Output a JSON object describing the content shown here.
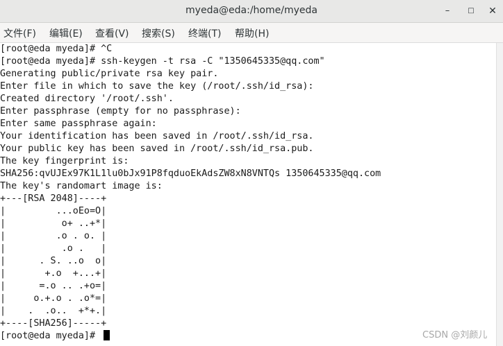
{
  "window": {
    "title": "myeda@eda:/home/myeda",
    "minimize_glyph": "–",
    "maximize_glyph": "□",
    "close_glyph": "✕"
  },
  "menu": {
    "items": [
      {
        "label": "文件(F)"
      },
      {
        "label": "编辑(E)"
      },
      {
        "label": "查看(V)"
      },
      {
        "label": "搜索(S)"
      },
      {
        "label": "终端(T)"
      },
      {
        "label": "帮助(H)"
      }
    ]
  },
  "terminal": {
    "lines": [
      "[root@eda myeda]# ^C",
      "[root@eda myeda]# ssh-keygen -t rsa -C \"1350645335@qq.com\"",
      "Generating public/private rsa key pair.",
      "Enter file in which to save the key (/root/.ssh/id_rsa):",
      "Created directory '/root/.ssh'.",
      "Enter passphrase (empty for no passphrase):",
      "Enter same passphrase again:",
      "Your identification has been saved in /root/.ssh/id_rsa.",
      "Your public key has been saved in /root/.ssh/id_rsa.pub.",
      "The key fingerprint is:",
      "SHA256:qvUJEx97K1L1lu0bJx91P8fqduoEkAdsZW8xN8VNTQs 1350645335@qq.com",
      "The key's randomart image is:",
      "+---[RSA 2048]----+",
      "|         ...oEo=O|",
      "|          o+ ..+*|",
      "|         .o . o. |",
      "|          .o .   |",
      "|      . S. ..o  o|",
      "|       +.o  +...+|",
      "|      =.o .. .+o=|",
      "|     o.+.o . .o*=|",
      "|    .  .o..  +*+.|",
      "+----[SHA256]-----+"
    ],
    "prompt": "[root@eda myeda]# "
  },
  "watermark": "CSDN @刘颜儿"
}
